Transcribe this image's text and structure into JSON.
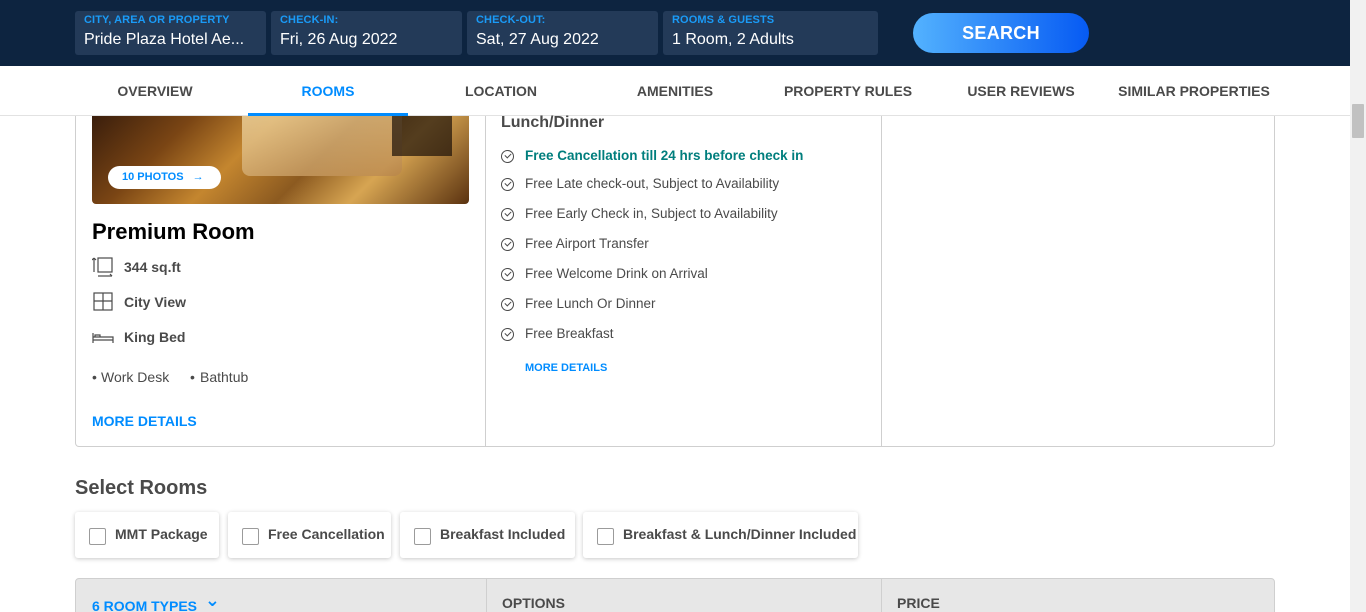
{
  "search": {
    "fields": [
      {
        "label": "CITY, AREA OR PROPERTY",
        "value": "Pride Plaza Hotel Ae..."
      },
      {
        "label": "CHECK-IN:",
        "value": "Fri, 26 Aug 2022"
      },
      {
        "label": "CHECK-OUT:",
        "value": "Sat, 27 Aug 2022"
      },
      {
        "label": "ROOMS & GUESTS",
        "value": "1 Room, 2 Adults"
      }
    ],
    "button_label": "SEARCH"
  },
  "nav": {
    "tabs": [
      "OVERVIEW",
      "ROOMS",
      "LOCATION",
      "AMENITIES",
      "PROPERTY RULES",
      "USER REVIEWS",
      "SIMILAR PROPERTIES"
    ],
    "active_tab": "ROOMS"
  },
  "room": {
    "photos_badge": "10 PHOTOS",
    "arrow": "→",
    "name": "Premium Room",
    "features": [
      {
        "icon": "room-size-icon",
        "text": "344 sq.ft"
      },
      {
        "icon": "window-view-icon",
        "text": "City View"
      },
      {
        "icon": "bed-icon",
        "text": "King Bed"
      }
    ],
    "bullet": "•",
    "extras": [
      "Work Desk",
      "Bathtub"
    ],
    "more_details": "MORE DETAILS"
  },
  "option": {
    "heading": "Lunch/Dinner",
    "inclusions": [
      {
        "text": "Free Cancellation till 24 hrs before check in",
        "highlight": true
      },
      {
        "text": "Free Late check-out, Subject to Availability",
        "highlight": false
      },
      {
        "text": "Free Early Check in, Subject to Availability",
        "highlight": false
      },
      {
        "text": "Free Airport Transfer",
        "highlight": false
      },
      {
        "text": "Free Welcome Drink on Arrival",
        "highlight": false
      },
      {
        "text": "Free Lunch Or Dinner",
        "highlight": false
      },
      {
        "text": "Free Breakfast",
        "highlight": false
      }
    ],
    "more_details": "MORE DETAILS"
  },
  "select_rooms": {
    "title": "Select Rooms",
    "filters": [
      "MMT Package",
      "Free Cancellation",
      "Breakfast Included",
      "Breakfast & Lunch/Dinner Included"
    ]
  },
  "table": {
    "room_types": "6 ROOM TYPES",
    "chevron": "⌄",
    "options": "OPTIONS",
    "price": "PRICE"
  },
  "colors": {
    "header_bg": "#0d2440",
    "field_bg": "#233a58",
    "accent": "#008cff",
    "green": "#007e7d"
  }
}
